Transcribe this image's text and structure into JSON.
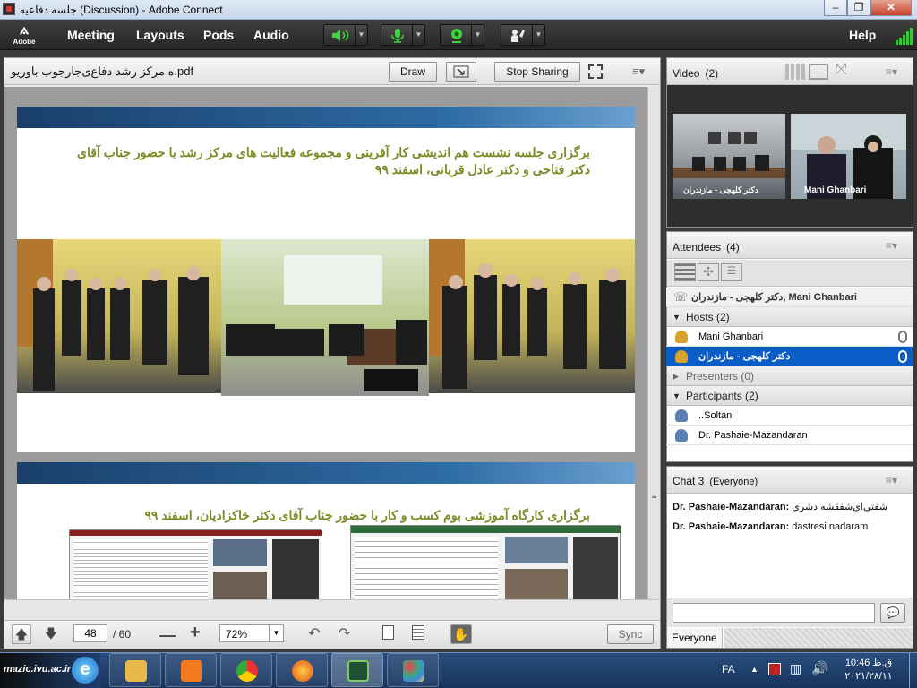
{
  "window": {
    "title": "جلسه دفاعیه (Discussion) - Adobe Connect",
    "min": "–",
    "restore": "❐",
    "close": "✕"
  },
  "menubar": {
    "logo_text": "Adobe",
    "items": [
      "Meeting",
      "Layouts",
      "Pods",
      "Audio"
    ],
    "help": "Help"
  },
  "share": {
    "filename": "ه مرکز رشد دفاع‌ی‌جارجوب باوریو.pdf",
    "draw": "Draw",
    "stop_sharing": "Stop Sharing",
    "slide1_title": "برگزاری جلسه نشست هم اندیشی کار آفرینی و مجموعه فعالیت های مرکز رشد  با حضور جناب آقای دکتر فتاحی و دکتر عادل قربانی، اسفند ۹۹",
    "slide2_title": "برگزاری کارگاه آموزشی بوم کسب و کار با حضور جناب آقای دکتر خاکزادیان، اسفند ۹۹",
    "page_current": "48",
    "page_total": "/ 60",
    "zoom": "72%",
    "sync": "Sync"
  },
  "video": {
    "title": "Video",
    "count": "(2)",
    "tiles": [
      {
        "label": "دکتر کلهجی - مازندران"
      },
      {
        "label": "Mani Ghanbari"
      }
    ]
  },
  "attendees": {
    "title": "Attendees",
    "count": "(4)",
    "speaking": "دکتر کلهجی - مازندران, Mani Ghanbari",
    "hosts_label": "Hosts (2)",
    "hosts": [
      "Mani Ghanbari",
      "دکتر کلهجی - مازندران"
    ],
    "presenters_label": "Presenters (0)",
    "participants_label": "Participants (2)",
    "participants": [
      "..Soltani",
      "Dr. Pashaie-Mazandaran"
    ]
  },
  "chat": {
    "title": "Chat 3",
    "scope": "(Everyone)",
    "messages": [
      {
        "author": "Dr. Pashaie-Mazandaran:",
        "text": "شفتی‌ای‌شفقشه دشری"
      },
      {
        "author": "Dr. Pashaie-Mazandaran:",
        "text": "dastresi nadaram"
      }
    ],
    "input_value": "",
    "audience": "Everyone"
  },
  "taskbar": {
    "brand": "mazic.ivu.ac.ir",
    "lang": "FA",
    "clock_time": "10:46 ق.ظ",
    "clock_date": "۲۰۲۱/۲۸/۱۱"
  },
  "colors": {
    "accent_blue": "#0a5cc7",
    "signal_green": "#3cc43c",
    "slide_title": "#7a8d25"
  }
}
